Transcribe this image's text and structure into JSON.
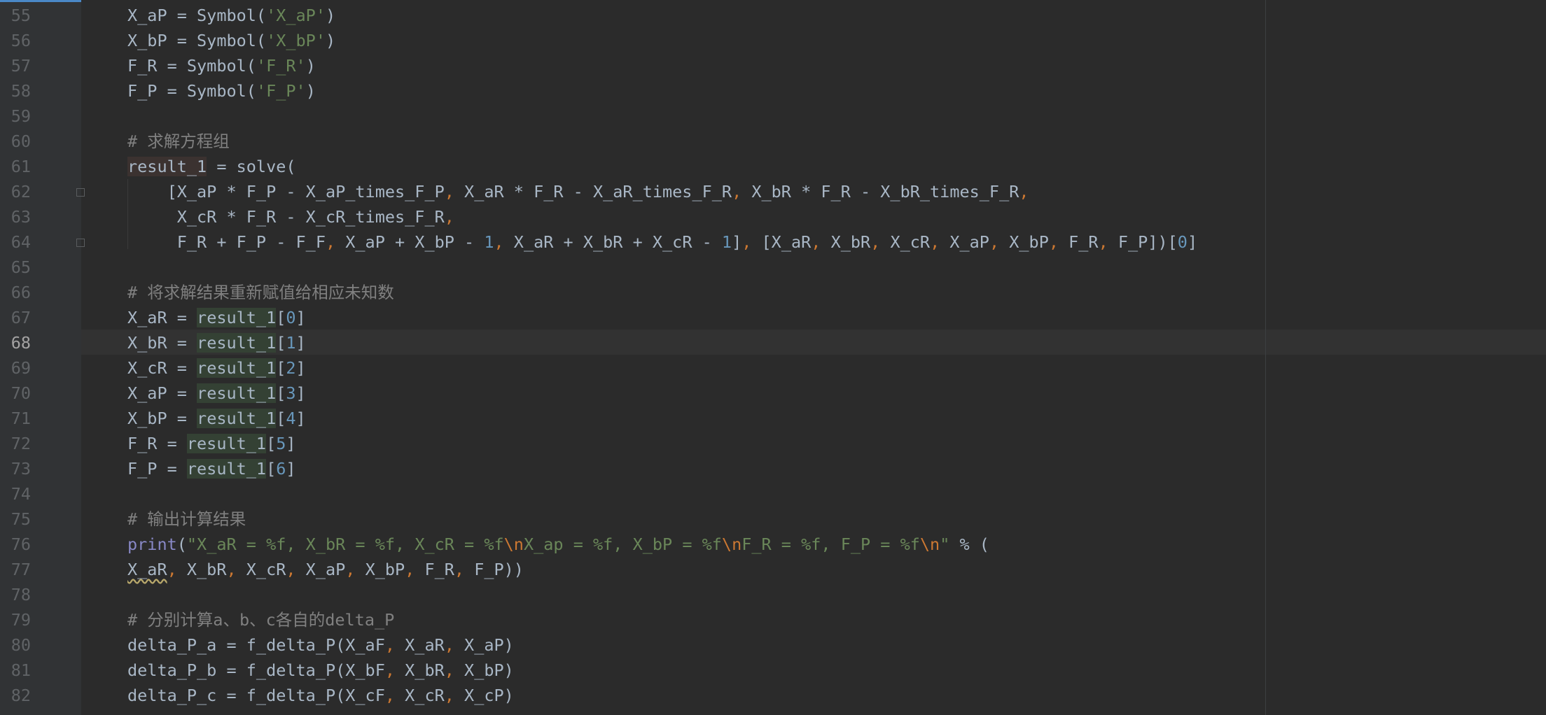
{
  "editor": {
    "active_line": 68,
    "lines": [
      {
        "n": "55",
        "segs": [
          [
            "",
            "X_aP = Symbol("
          ],
          [
            "str",
            "'X_aP'"
          ],
          [
            "",
            ")"
          ]
        ]
      },
      {
        "n": "56",
        "segs": [
          [
            "",
            "X_bP = Symbol("
          ],
          [
            "str",
            "'X_bP'"
          ],
          [
            "",
            ")"
          ]
        ]
      },
      {
        "n": "57",
        "segs": [
          [
            "",
            "F_R = Symbol("
          ],
          [
            "str",
            "'F_R'"
          ],
          [
            "",
            ")"
          ]
        ]
      },
      {
        "n": "58",
        "segs": [
          [
            "",
            "F_P = Symbol("
          ],
          [
            "str",
            "'F_P'"
          ],
          [
            "",
            ")"
          ]
        ]
      },
      {
        "n": "59",
        "segs": []
      },
      {
        "n": "60",
        "segs": [
          [
            "cmt",
            "# 求解方程组"
          ]
        ]
      },
      {
        "n": "61",
        "segs": [
          [
            "res",
            "result_1"
          ],
          [
            "",
            " = solve("
          ]
        ]
      },
      {
        "n": "62",
        "segs": [
          [
            "",
            "    [X_aP * F_P - X_aP_times_F_P"
          ],
          [
            "kw",
            ", "
          ],
          [
            "",
            "X_aR * F_R - X_aR_times_F_R"
          ],
          [
            "kw",
            ", "
          ],
          [
            "",
            "X_bR * F_R - X_bR_times_F_R"
          ],
          [
            "kw",
            ","
          ]
        ]
      },
      {
        "n": "63",
        "segs": [
          [
            "",
            "     X_cR * F_R - X_cR_times_F_R"
          ],
          [
            "kw",
            ","
          ]
        ]
      },
      {
        "n": "64",
        "segs": [
          [
            "",
            "     F_R + F_P - F_F"
          ],
          [
            "kw",
            ", "
          ],
          [
            "",
            "X_aP + X_bP - "
          ],
          [
            "num",
            "1"
          ],
          [
            "kw",
            ", "
          ],
          [
            "",
            "X_aR + X_bR + X_cR - "
          ],
          [
            "num",
            "1"
          ],
          [
            "",
            "]"
          ],
          [
            "kw",
            ", "
          ],
          [
            "",
            "[X_aR"
          ],
          [
            "kw",
            ", "
          ],
          [
            "",
            "X_bR"
          ],
          [
            "kw",
            ", "
          ],
          [
            "",
            "X_cR"
          ],
          [
            "kw",
            ", "
          ],
          [
            "",
            "X_aP"
          ],
          [
            "kw",
            ", "
          ],
          [
            "",
            "X_bP"
          ],
          [
            "kw",
            ", "
          ],
          [
            "",
            "F_R"
          ],
          [
            "kw",
            ", "
          ],
          [
            "",
            "F_P])["
          ],
          [
            "num",
            "0"
          ],
          [
            "",
            "]"
          ]
        ]
      },
      {
        "n": "65",
        "segs": []
      },
      {
        "n": "66",
        "segs": [
          [
            "cmt",
            "# 将求解结果重新赋值给相应未知数"
          ]
        ]
      },
      {
        "n": "67",
        "segs": [
          [
            "",
            "X_aR = "
          ],
          [
            "def",
            "result_1"
          ],
          [
            "",
            "["
          ],
          [
            "num",
            "0"
          ],
          [
            "",
            "]"
          ]
        ]
      },
      {
        "n": "68",
        "segs": [
          [
            "",
            "X_bR = "
          ],
          [
            "def",
            "result_1"
          ],
          [
            "",
            "["
          ],
          [
            "num",
            "1"
          ],
          [
            "",
            "]"
          ]
        ]
      },
      {
        "n": "69",
        "segs": [
          [
            "",
            "X_cR = "
          ],
          [
            "def",
            "result_1"
          ],
          [
            "",
            "["
          ],
          [
            "num",
            "2"
          ],
          [
            "",
            "]"
          ]
        ]
      },
      {
        "n": "70",
        "segs": [
          [
            "",
            "X_aP = "
          ],
          [
            "def",
            "result_1"
          ],
          [
            "",
            "["
          ],
          [
            "num",
            "3"
          ],
          [
            "",
            "]"
          ]
        ]
      },
      {
        "n": "71",
        "segs": [
          [
            "",
            "X_bP = "
          ],
          [
            "def",
            "result_1"
          ],
          [
            "",
            "["
          ],
          [
            "num",
            "4"
          ],
          [
            "",
            "]"
          ]
        ]
      },
      {
        "n": "72",
        "segs": [
          [
            "",
            "F_R = "
          ],
          [
            "def",
            "result_1"
          ],
          [
            "",
            "["
          ],
          [
            "num",
            "5"
          ],
          [
            "",
            "]"
          ]
        ]
      },
      {
        "n": "73",
        "segs": [
          [
            "",
            "F_P = "
          ],
          [
            "def",
            "result_1"
          ],
          [
            "",
            "["
          ],
          [
            "num",
            "6"
          ],
          [
            "",
            "]"
          ]
        ]
      },
      {
        "n": "74",
        "segs": []
      },
      {
        "n": "75",
        "segs": [
          [
            "cmt",
            "# 输出计算结果"
          ]
        ]
      },
      {
        "n": "76",
        "segs": [
          [
            "bi",
            "print"
          ],
          [
            "",
            "("
          ],
          [
            "str",
            "\"X_aR = %f, X_bR = %f, X_cR = %f"
          ],
          [
            "esc",
            "\\n"
          ],
          [
            "str",
            "X_ap = %f, X_bP = %f"
          ],
          [
            "esc",
            "\\n"
          ],
          [
            "str",
            "F_R = %f, F_P = %f"
          ],
          [
            "esc",
            "\\n"
          ],
          [
            "str",
            "\""
          ],
          [
            "",
            " % ("
          ]
        ]
      },
      {
        "n": "77",
        "segs": [
          [
            "squig",
            "X_aR"
          ],
          [
            "kw",
            ", "
          ],
          [
            "",
            "X_bR"
          ],
          [
            "kw",
            ", "
          ],
          [
            "",
            "X_cR"
          ],
          [
            "kw",
            ", "
          ],
          [
            "",
            "X_aP"
          ],
          [
            "kw",
            ", "
          ],
          [
            "",
            "X_bP"
          ],
          [
            "kw",
            ", "
          ],
          [
            "",
            "F_R"
          ],
          [
            "kw",
            ", "
          ],
          [
            "",
            "F_P))"
          ]
        ]
      },
      {
        "n": "78",
        "segs": []
      },
      {
        "n": "79",
        "segs": [
          [
            "cmt",
            "# 分别计算a、b、c各自的delta_P"
          ]
        ]
      },
      {
        "n": "80",
        "segs": [
          [
            "",
            "delta_P_a = f_delta_P(X_aF"
          ],
          [
            "kw",
            ", "
          ],
          [
            "",
            "X_aR"
          ],
          [
            "kw",
            ", "
          ],
          [
            "",
            "X_aP)"
          ]
        ]
      },
      {
        "n": "81",
        "segs": [
          [
            "",
            "delta_P_b = f_delta_P(X_bF"
          ],
          [
            "kw",
            ", "
          ],
          [
            "",
            "X_bR"
          ],
          [
            "kw",
            ", "
          ],
          [
            "",
            "X_bP)"
          ]
        ]
      },
      {
        "n": "82",
        "segs": [
          [
            "",
            "delta_P_c = f_delta_P(X_cF"
          ],
          [
            "kw",
            ", "
          ],
          [
            "",
            "X_cR"
          ],
          [
            "kw",
            ", "
          ],
          [
            "",
            "X_cP)"
          ]
        ]
      }
    ]
  }
}
